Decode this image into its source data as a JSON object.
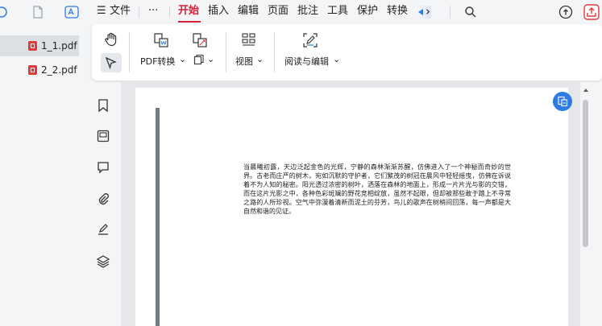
{
  "menu": {
    "hamburger": "☰",
    "file": "文件",
    "more": "···",
    "items": [
      "开始",
      "插入",
      "编辑",
      "页面",
      "批注",
      "工具",
      "保护",
      "转换"
    ],
    "scroll_right": "›"
  },
  "files": [
    {
      "name": "1_1.pdf",
      "selected": true
    },
    {
      "name": "2_2.pdf",
      "selected": false
    }
  ],
  "ribbon": {
    "pdf_convert": "PDF转换",
    "view": "视图",
    "read_edit": "阅读与编辑",
    "caret": "⌄"
  },
  "document": {
    "paragraph": "当晨曦初露，天边泛起金色的光辉，宁静的森林渐渐苏醒，仿佛进入了一个神秘而奇妙的世界。古老而庄严的树木，宛如沉默的守护者，它们繁茂的树冠在晨风中轻轻摇曳，仿佛在诉说着不为人知的秘密。阳光透过浓密的树叶，洒落在森林的地面上，形成一片片光与影的交错，而在这片光影之中，各种色彩斑斓的野花竞相绽放，虽然不起眼，但却被那些敢于踏上不寻常之路的人所珍视。空气中弥漫着清新而泥土的芬芳，鸟儿的歌声在树梢间回荡，每一声都是大自然和谐的见证。"
  },
  "colors": {
    "accent": "#d6203b",
    "blue": "#2f7be6",
    "pdf_red": "#e03a3a"
  }
}
